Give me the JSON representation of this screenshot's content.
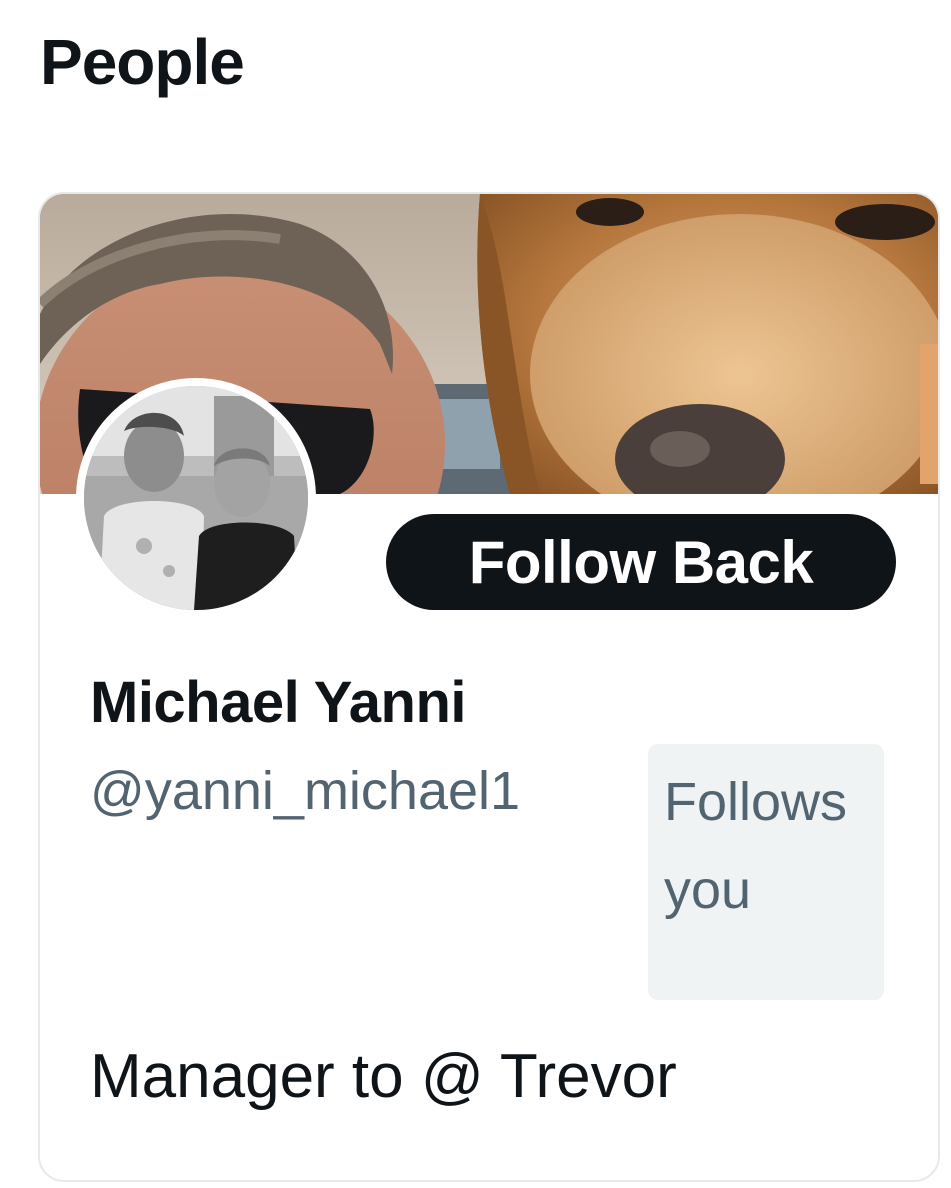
{
  "section": {
    "title": "People"
  },
  "user_card": {
    "banner_alt": "profile banner photo",
    "avatar_alt": "profile avatar photo",
    "follow_button_label": "Follow Back",
    "display_name": "Michael Yanni",
    "handle": "@yanni_michael1",
    "follows_you_badge": "Follows you",
    "bio": "Manager to @ Trevor"
  },
  "colors": {
    "primary_text": "#0f1419",
    "secondary_text": "#536471",
    "badge_bg": "#eff3f4",
    "button_bg": "#0f1419",
    "button_text": "#ffffff",
    "card_border": "#e6e9ec"
  }
}
